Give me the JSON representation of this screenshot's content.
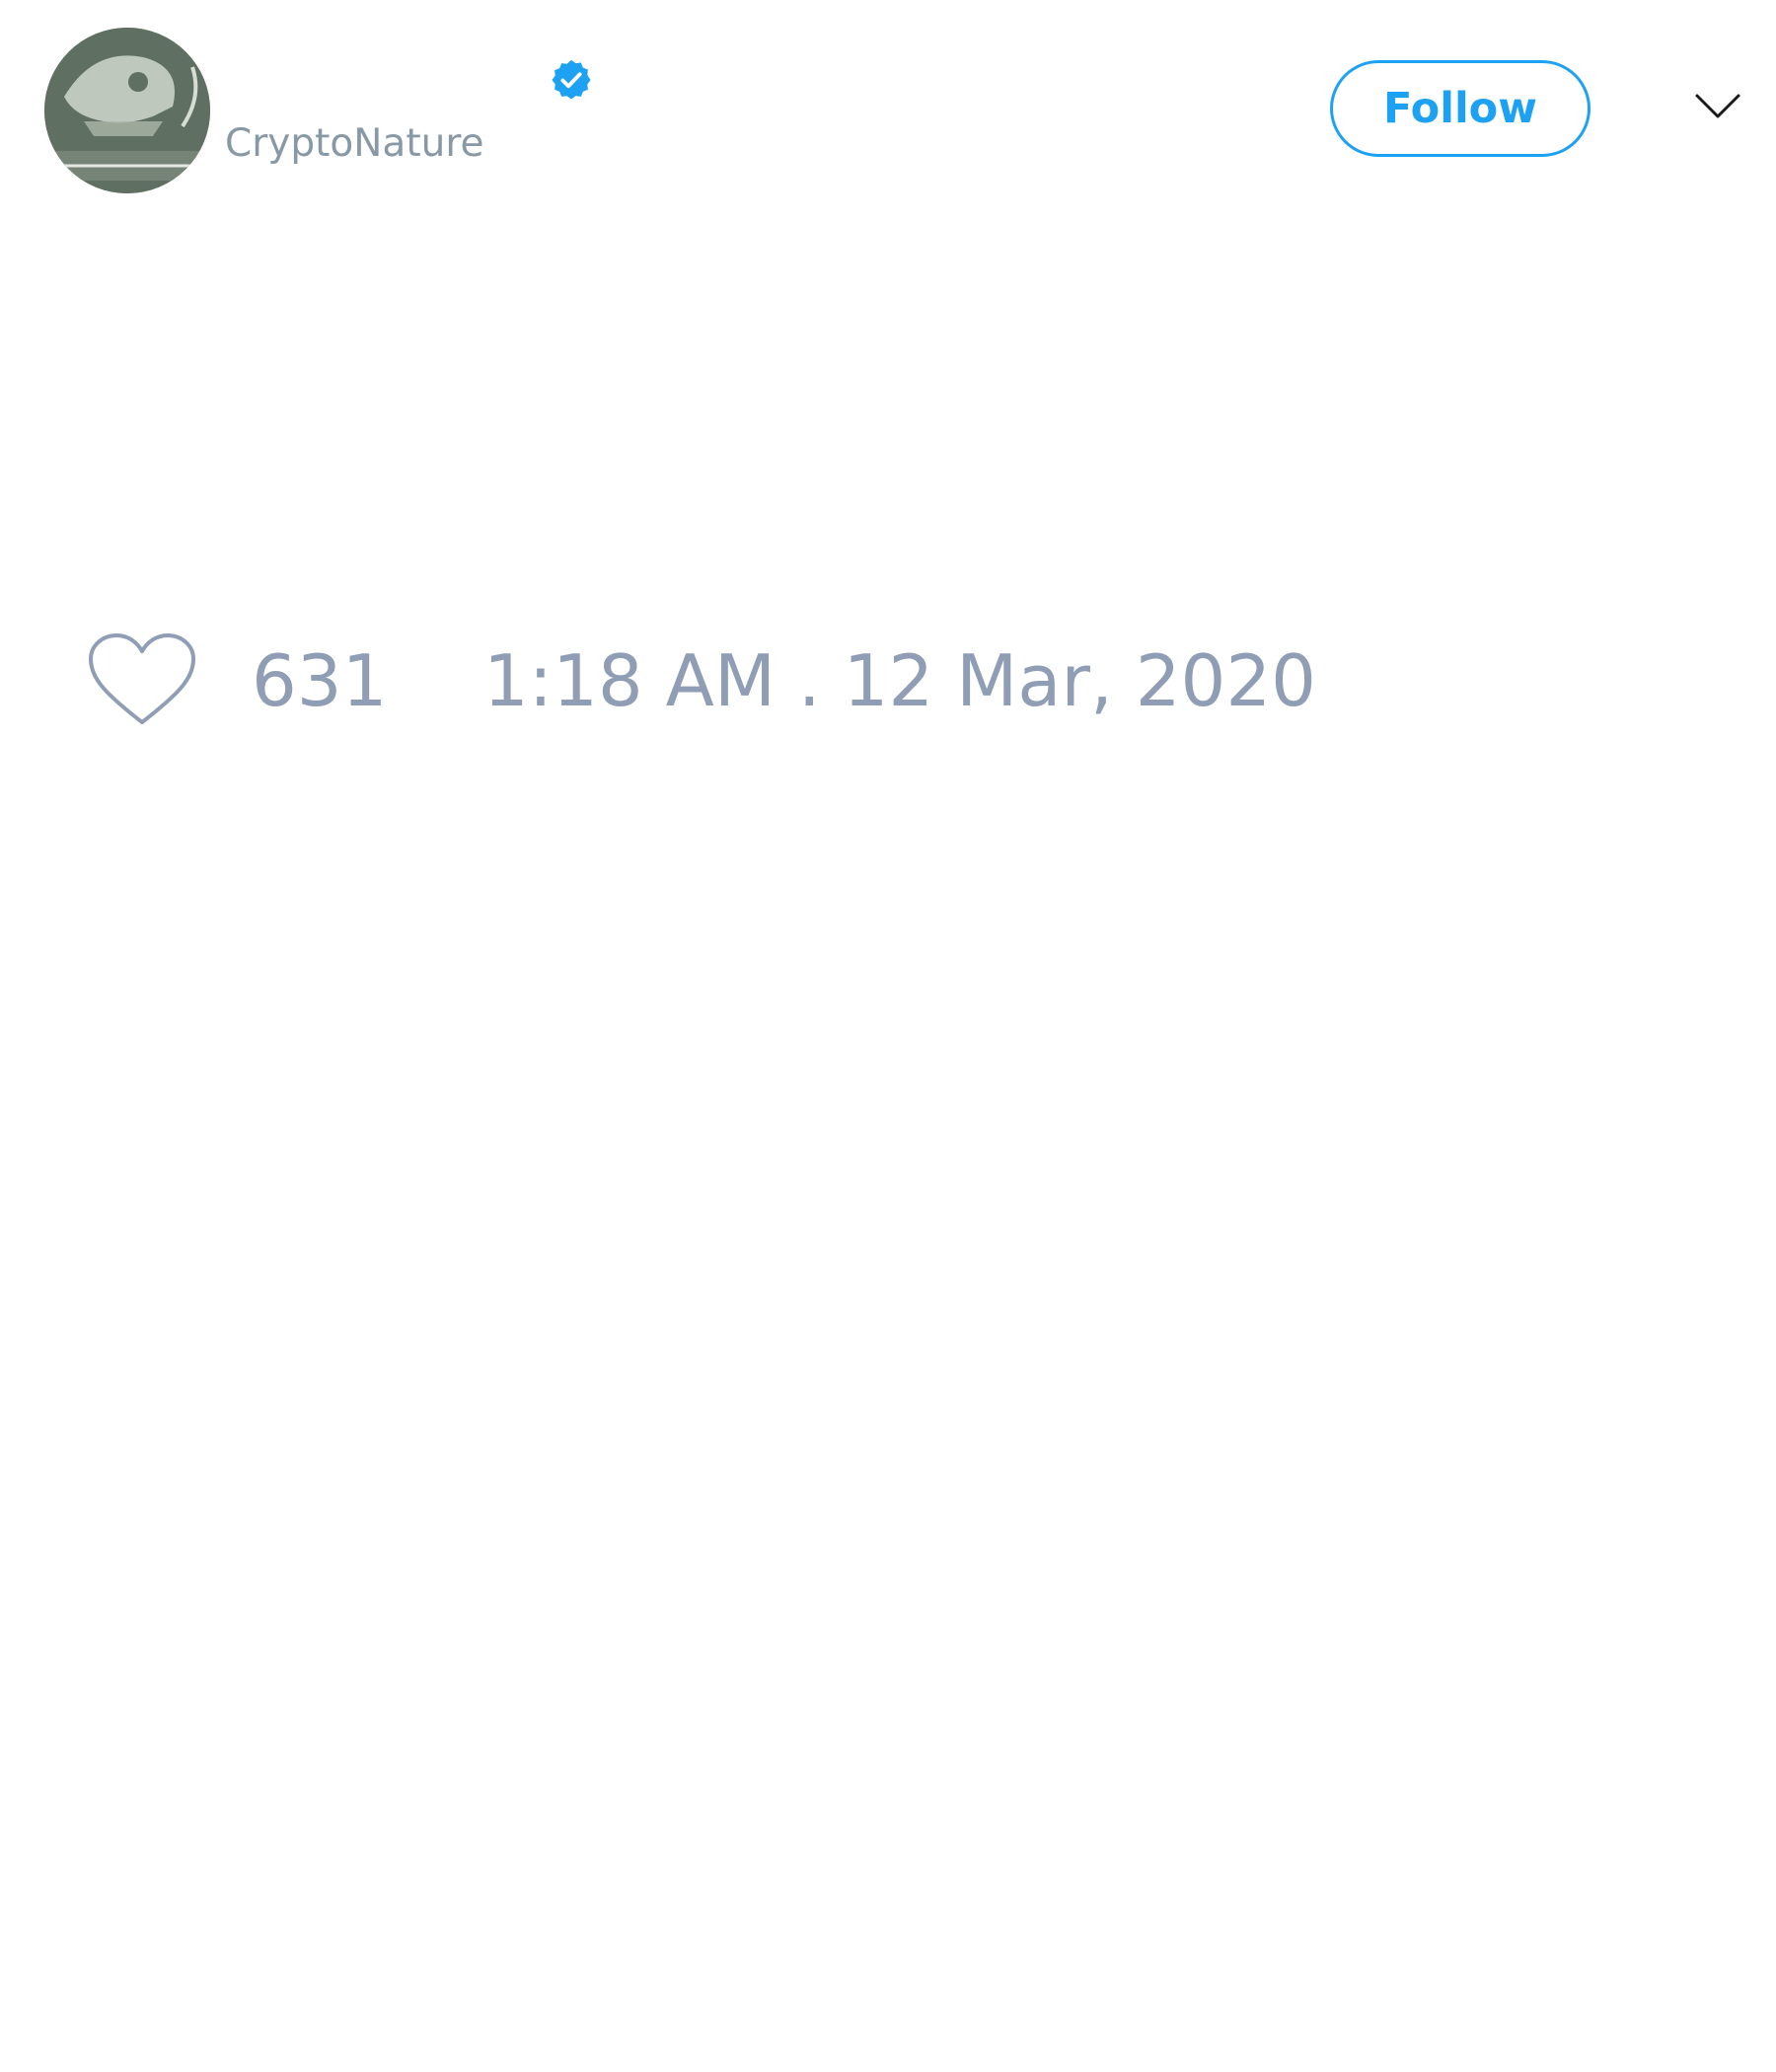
{
  "author": {
    "handle": "CryptoNature",
    "verified": true,
    "avatar_icon": "avatar-image"
  },
  "header": {
    "follow_label": "Follow",
    "menu_icon": "chevron-down-icon"
  },
  "tweet": {
    "likes": "631",
    "timestamp": "1:18 AM . 12 Mar, 2020",
    "like_icon": "heart-icon"
  },
  "colors": {
    "accent": "#1da1f2",
    "muted_text": "#8f9eb4",
    "background": "#ffffff"
  }
}
